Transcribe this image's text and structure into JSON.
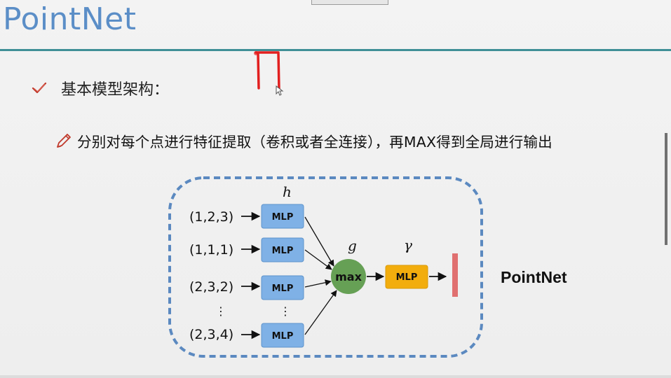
{
  "slide": {
    "title": "PointNet",
    "bullet": "基本模型架构：",
    "sub_bullet": "分别对每个点进行特征提取（卷积或者全连接），再MAX得到全局进行输出"
  },
  "diagram": {
    "inputs": [
      "(1,2,3)",
      "(1,1,1)",
      "(2,3,2)",
      "(2,3,4)"
    ],
    "ellipsis": "⋮",
    "mlp_label": "MLP",
    "h_label": "h",
    "g_label": "g",
    "gamma_label": "γ",
    "max_label": "max",
    "output_label": "PointNet",
    "colors": {
      "mlp_blue": "#7fb1e6",
      "max_green": "#66a055",
      "gamma_orange": "#f2ad0d",
      "output_red": "#e07070",
      "dashed_border": "#5b89c0"
    }
  },
  "icons": {
    "check": "check-icon",
    "pencil": "pencil-icon",
    "cursor": "cursor-icon"
  }
}
